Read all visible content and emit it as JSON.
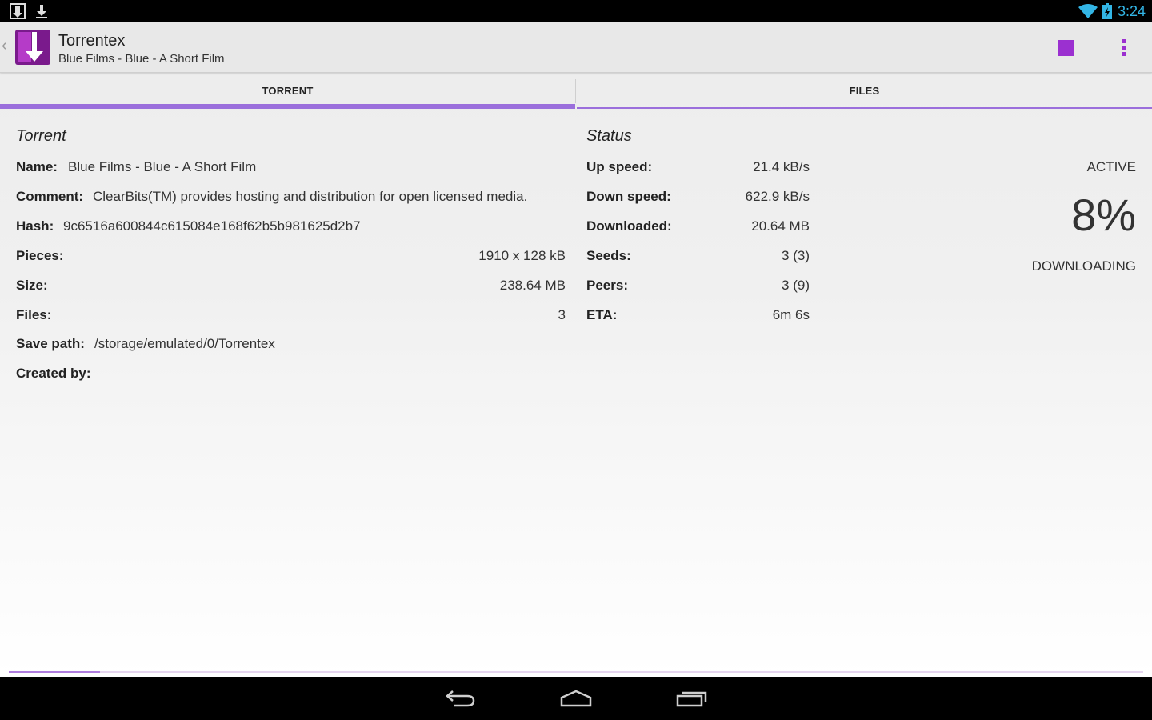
{
  "status_bar": {
    "time": "3:24",
    "left_icons": [
      "torrentex-notification-icon",
      "download-icon"
    ],
    "right_icons": [
      "wifi-icon",
      "battery-icon"
    ],
    "accent_color": "#33b5e5"
  },
  "action_bar": {
    "title": "Torrentex",
    "subtitle": "Blue Films - Blue - A Short Film",
    "up_icon": "chevron-left-icon",
    "actions": [
      "stop-icon",
      "overflow-menu-icon"
    ],
    "accent_color": "#9b30d0"
  },
  "tabs": [
    {
      "label": "TORRENT",
      "selected": true
    },
    {
      "label": "FILES",
      "selected": false
    }
  ],
  "torrent": {
    "section_title": "Torrent",
    "name_label": "Name:",
    "name": "Blue Films - Blue - A Short Film",
    "comment_label": "Comment:",
    "comment": "ClearBits(TM) provides hosting and distribution for open licensed media.",
    "hash_label": "Hash:",
    "hash": "9c6516a600844c615084e168f62b5b981625d2b7",
    "pieces_label": "Pieces:",
    "pieces": "1910 x 128 kB",
    "size_label": "Size:",
    "size": "238.64 MB",
    "files_label": "Files:",
    "files": "3",
    "save_path_label": "Save path:",
    "save_path": "/storage/emulated/0/Torrentex",
    "created_by_label": "Created by:",
    "created_by": ""
  },
  "status": {
    "section_title": "Status",
    "up_speed_label": "Up speed:",
    "up_speed": "21.4 kB/s",
    "down_speed_label": "Down speed:",
    "down_speed": "622.9 kB/s",
    "downloaded_label": "Downloaded:",
    "downloaded": "20.64 MB",
    "seeds_label": "Seeds:",
    "seeds": "3 (3)",
    "peers_label": "Peers:",
    "peers": "3 (9)",
    "eta_label": "ETA:",
    "eta": "6m 6s",
    "state": "ACTIVE",
    "progress": "8%",
    "phase": "DOWNLOADING"
  },
  "pager": {
    "page_indicator_fraction": 0.08
  },
  "nav_bar": [
    "back-icon",
    "home-icon",
    "recent-apps-icon"
  ]
}
